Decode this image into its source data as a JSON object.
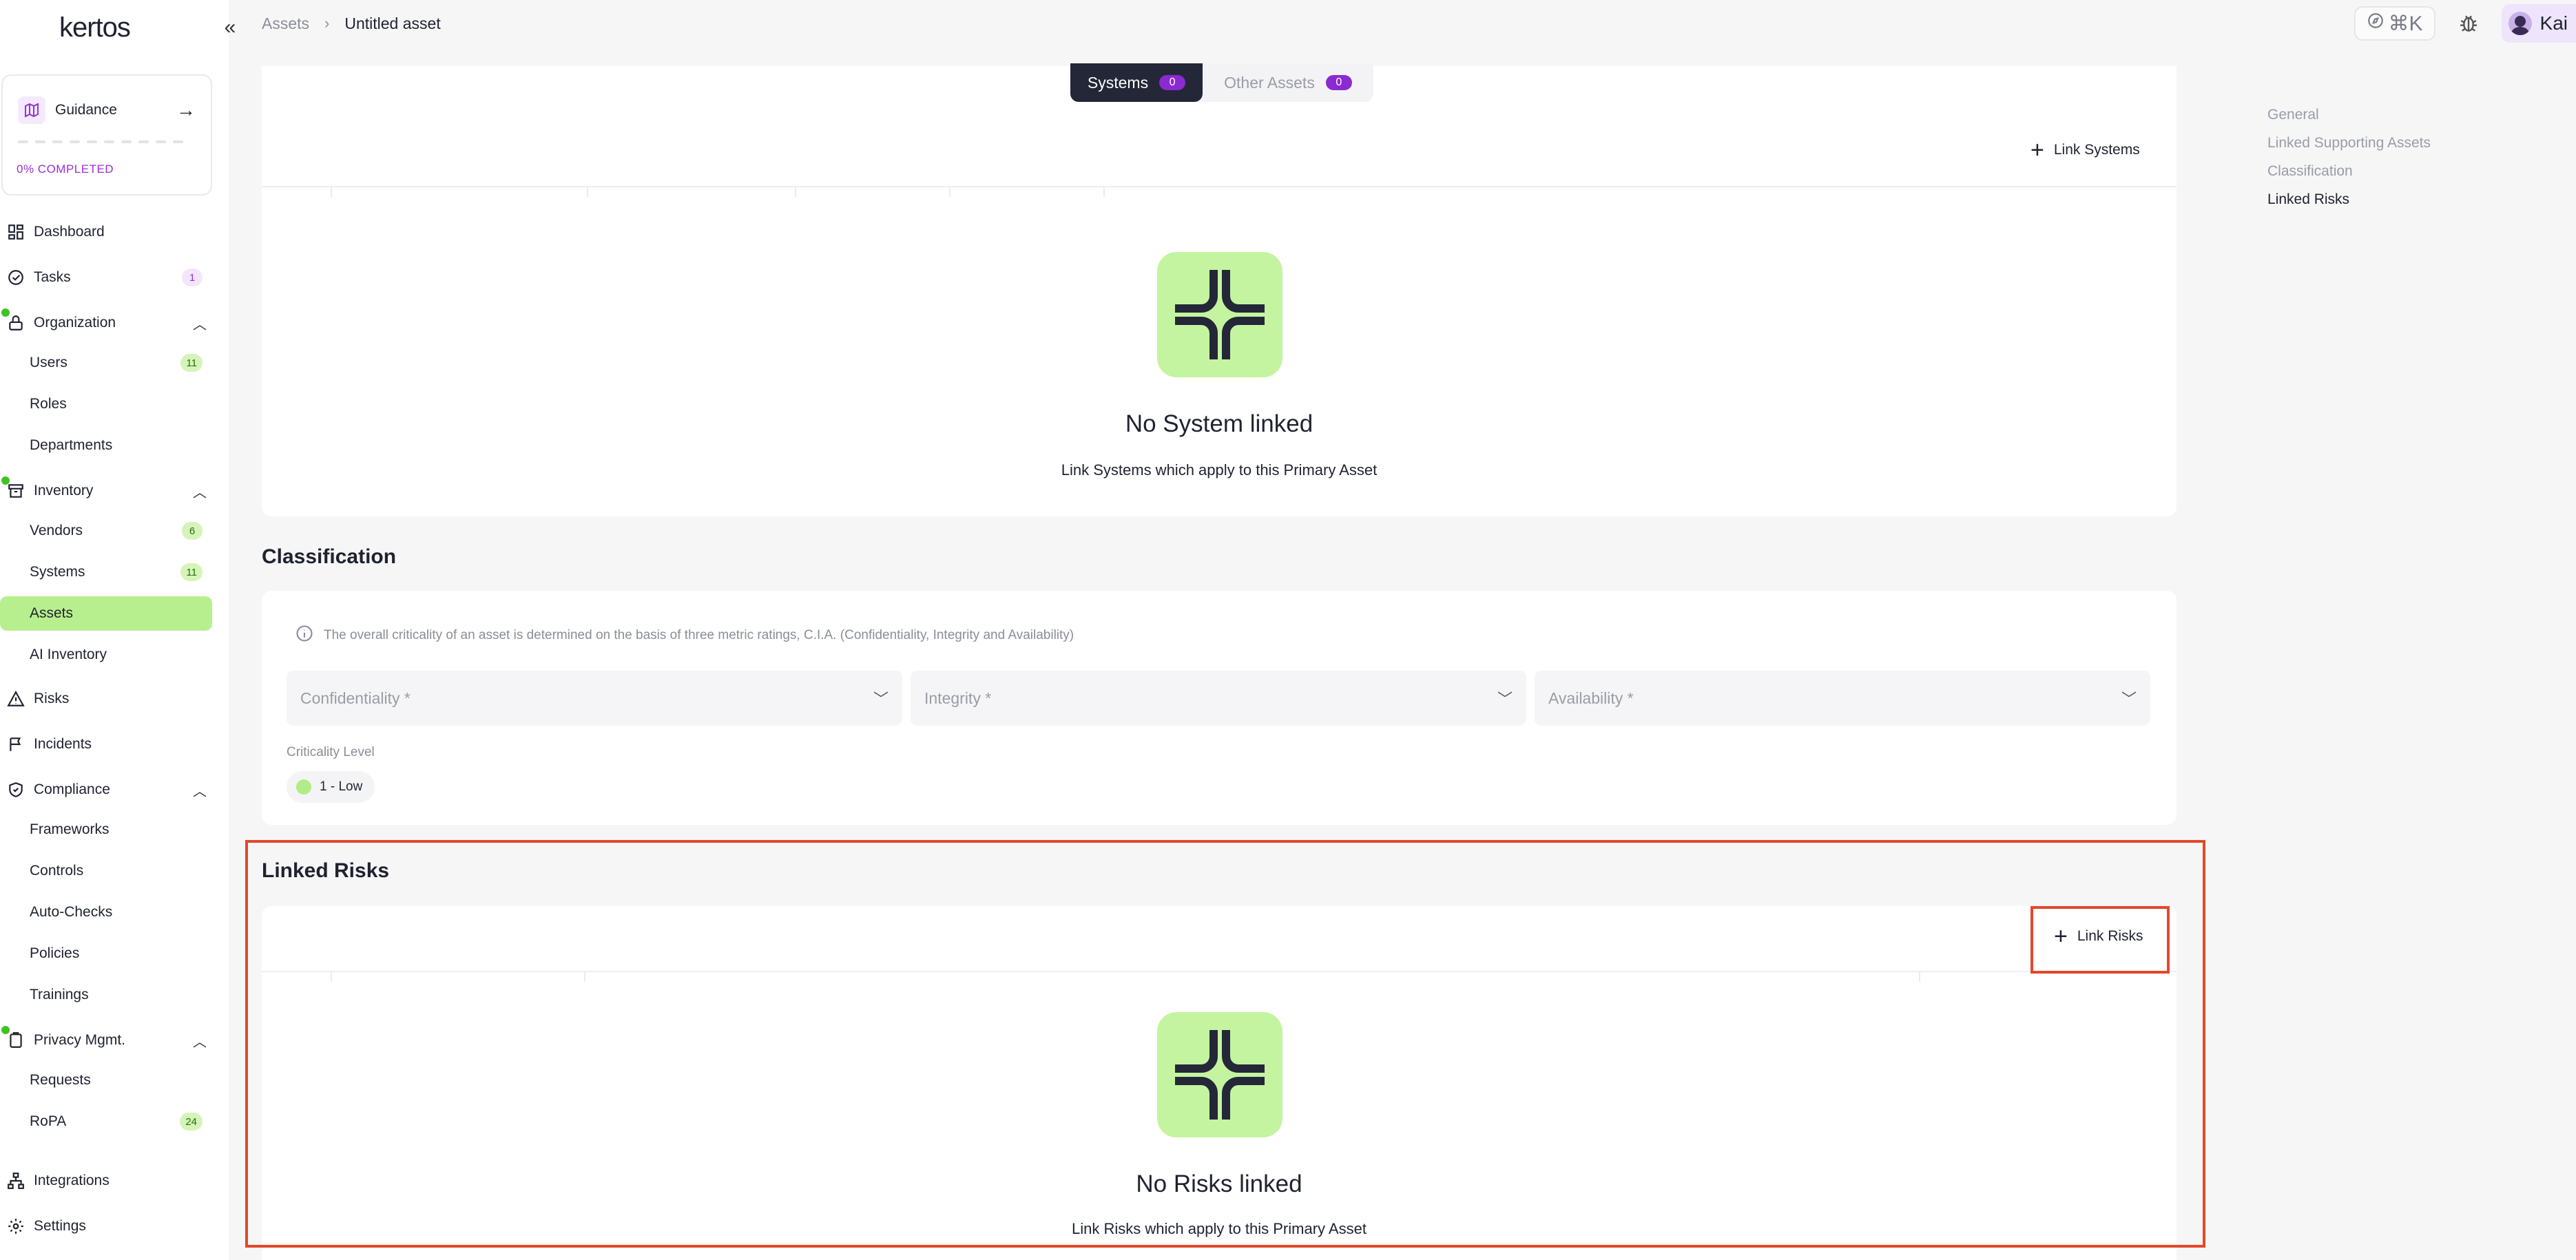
{
  "brand": {
    "logo_text": "kertos"
  },
  "guidance": {
    "label": "Guidance",
    "progress_label": "0% COMPLETED"
  },
  "nav": {
    "dashboard": "Dashboard",
    "tasks": {
      "label": "Tasks",
      "badge": "1"
    },
    "organization": "Organization",
    "users": {
      "label": "Users",
      "badge": "11"
    },
    "roles": "Roles",
    "departments": "Departments",
    "inventory": "Inventory",
    "vendors": {
      "label": "Vendors",
      "badge": "6"
    },
    "systems": {
      "label": "Systems",
      "badge": "11"
    },
    "assets": "Assets",
    "ai_inventory": "AI Inventory",
    "risks": "Risks",
    "incidents": "Incidents",
    "compliance": "Compliance",
    "frameworks": "Frameworks",
    "controls": "Controls",
    "auto_checks": "Auto-Checks",
    "policies": "Policies",
    "trainings": "Trainings",
    "privacy": "Privacy Mgmt.",
    "requests": "Requests",
    "ropa": {
      "label": "RoPA",
      "badge": "24"
    },
    "integrations": "Integrations",
    "settings": "Settings"
  },
  "breadcrumb": {
    "parent": "Assets",
    "current": "Untitled asset"
  },
  "topbar": {
    "shortcut": "⌘K",
    "user_name": "Kai"
  },
  "toc": {
    "items": [
      "General",
      "Linked Supporting Assets",
      "Classification",
      "Linked Risks"
    ],
    "active": "Linked Risks"
  },
  "supporting": {
    "tab_systems": "Systems",
    "tab_systems_count": "0",
    "tab_other": "Other Assets",
    "tab_other_count": "0",
    "link_button": "Link Systems",
    "empty_title": "No System linked",
    "empty_subtitle": "Link Systems which apply to this Primary Asset"
  },
  "classification": {
    "title": "Classification",
    "info": "The overall criticality of an asset is determined on the basis of three metric ratings, C.I.A. (Confidentiality, Integrity and Availability)",
    "confidentiality_placeholder": "Confidentiality *",
    "integrity_placeholder": "Integrity *",
    "availability_placeholder": "Availability *",
    "criticality_label": "Criticality Level",
    "criticality_value": "1 - Low"
  },
  "risks": {
    "title": "Linked Risks",
    "link_button": "Link Risks",
    "empty_title": "No Risks linked",
    "empty_subtitle": "Link Risks which apply to this Primary Asset"
  },
  "colors": {
    "accent_green": "#b8ef8e",
    "accent_purple": "#8b2ad0",
    "highlight": "#e4472a",
    "dark": "#232738"
  }
}
